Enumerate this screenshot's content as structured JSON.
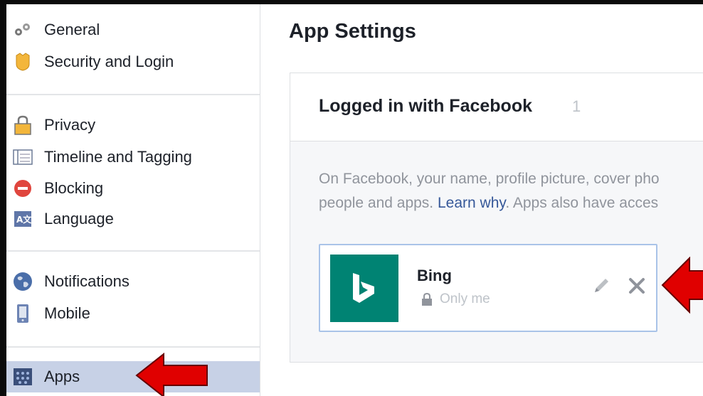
{
  "sidebar": {
    "items": [
      {
        "label": "General",
        "icon": "gears-icon"
      },
      {
        "label": "Security and Login",
        "icon": "badge-icon"
      },
      {
        "label": "Privacy",
        "icon": "padlock-icon"
      },
      {
        "label": "Timeline and Tagging",
        "icon": "timeline-icon"
      },
      {
        "label": "Blocking",
        "icon": "block-icon"
      },
      {
        "label": "Language",
        "icon": "language-icon"
      },
      {
        "label": "Notifications",
        "icon": "globe-icon"
      },
      {
        "label": "Mobile",
        "icon": "mobile-icon"
      },
      {
        "label": "Apps",
        "icon": "apps-icon",
        "selected": true
      }
    ]
  },
  "main": {
    "title": "App Settings",
    "panel": {
      "title": "Logged in with Facebook",
      "count": "1",
      "description_line1": "On Facebook, your name, profile picture, cover pho",
      "description_line2_a": "people and apps. ",
      "description_link": "Learn why",
      "description_line2_b": ". Apps also have acces"
    },
    "app": {
      "name": "Bing",
      "privacy": "Only me",
      "logo_letter": "b"
    }
  },
  "colors": {
    "selected_bg": "#c7d1e6",
    "bing_teal": "#008373",
    "link": "#365899",
    "arrow": "#e00000"
  }
}
